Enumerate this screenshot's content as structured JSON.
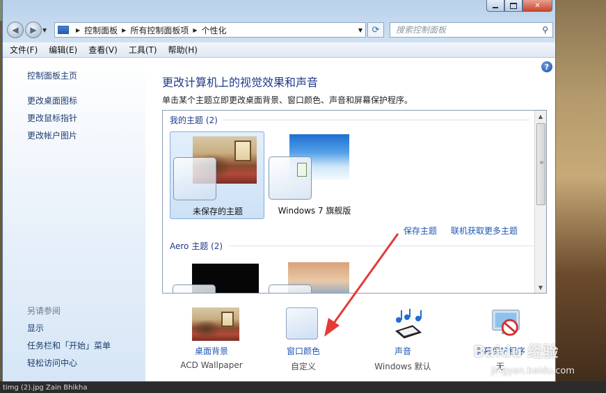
{
  "window": {
    "minimize_icon": "minimize-icon",
    "maximize_icon": "maximize-icon",
    "close_glyph": "✕"
  },
  "nav": {
    "breadcrumb": [
      "控制面板",
      "所有控制面板项",
      "个性化"
    ],
    "search_placeholder": "搜索控制面板"
  },
  "menu": [
    "文件(F)",
    "编辑(E)",
    "查看(V)",
    "工具(T)",
    "帮助(H)"
  ],
  "sidebar": {
    "home": "控制面板主页",
    "links": [
      "更改桌面图标",
      "更改鼠标指针",
      "更改帐户图片"
    ],
    "see_also_heading": "另请参阅",
    "see_also": [
      "显示",
      "任务栏和「开始」菜单",
      "轻松访问中心"
    ]
  },
  "main": {
    "title": "更改计算机上的视觉效果和声音",
    "description": "单击某个主题立即更改桌面背景、窗口颜色、声音和屏幕保护程序。",
    "my_themes": {
      "header": "我的主题 (2)",
      "items": [
        {
          "label": "未保存的主题",
          "selected": true
        },
        {
          "label": "Windows 7 旗舰版",
          "selected": false
        }
      ]
    },
    "save_theme": "保存主题",
    "get_more": "联机获取更多主题",
    "aero_header": "Aero 主题 (2)"
  },
  "settings": [
    {
      "label": "桌面背景",
      "value": "ACD Wallpaper"
    },
    {
      "label": "窗口颜色",
      "value": "自定义"
    },
    {
      "label": "声音",
      "value": "Windows 默认"
    },
    {
      "label": "屏幕保护程序",
      "value": "无"
    }
  ],
  "watermark": {
    "logo": "Baidu 经验",
    "url": "jingyan.baidu.com"
  },
  "taskbar": {
    "text": "timg (2).jpg  Zain Bhikha"
  },
  "colors": {
    "link": "#1f56b4",
    "title": "#1e3a8a",
    "arrow": "#e53935"
  }
}
